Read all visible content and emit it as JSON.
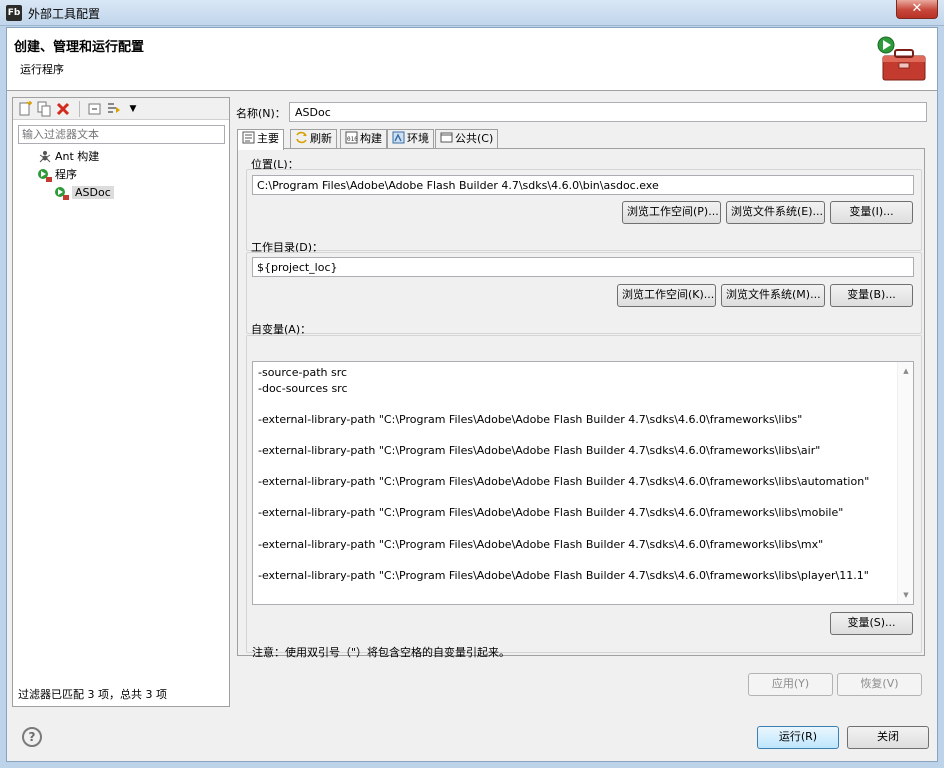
{
  "window": {
    "title": "外部工具配置",
    "app_icon_text": "Fb",
    "close_label": "✕"
  },
  "header": {
    "title": "创建、管理和运行配置",
    "subtitle": "运行程序"
  },
  "left": {
    "filter_placeholder": "输入过滤器文本",
    "tree": [
      {
        "label": "Ant 构建"
      },
      {
        "label": "程序"
      },
      {
        "label": "ASDoc",
        "selected": true
      }
    ],
    "status": "过滤器已匹配 3 项，总共 3 项"
  },
  "config": {
    "name_label": "名称(N)：",
    "name_value": "ASDoc",
    "tabs": [
      {
        "label": "主要",
        "active": true
      },
      {
        "label": "刷新"
      },
      {
        "label": "构建"
      },
      {
        "label": "环境"
      },
      {
        "label": "公共(C)"
      }
    ],
    "location": {
      "label": "位置(L)：",
      "value": "C:\\Program Files\\Adobe\\Adobe Flash Builder 4.7\\sdks\\4.6.0\\bin\\asdoc.exe",
      "browse_workspace": "浏览工作空间(P)...",
      "browse_fs": "浏览文件系统(E)...",
      "variables": "变量(I)..."
    },
    "workdir": {
      "label": "工作目录(D)：",
      "value": "${project_loc}",
      "browse_workspace": "浏览工作空间(K)...",
      "browse_fs": "浏览文件系统(M)...",
      "variables": "变量(B)..."
    },
    "arguments": {
      "label": "自变量(A)：",
      "lines": [
        "-source-path src",
        "-doc-sources src",
        "",
        "-external-library-path \"C:\\Program Files\\Adobe\\Adobe Flash Builder 4.7\\sdks\\4.6.0\\frameworks\\libs\"",
        "",
        "-external-library-path \"C:\\Program Files\\Adobe\\Adobe Flash Builder 4.7\\sdks\\4.6.0\\frameworks\\libs\\air\"",
        "",
        "-external-library-path \"C:\\Program Files\\Adobe\\Adobe Flash Builder 4.7\\sdks\\4.6.0\\frameworks\\libs\\automation\"",
        "",
        "-external-library-path \"C:\\Program Files\\Adobe\\Adobe Flash Builder 4.7\\sdks\\4.6.0\\frameworks\\libs\\mobile\"",
        "",
        "-external-library-path \"C:\\Program Files\\Adobe\\Adobe Flash Builder 4.7\\sdks\\4.6.0\\frameworks\\libs\\mx\"",
        "",
        "-external-library-path \"C:\\Program Files\\Adobe\\Adobe Flash Builder 4.7\\sdks\\4.6.0\\frameworks\\libs\\player\\11.1\""
      ],
      "variables": "变量(S)..."
    },
    "note": "注意：使用双引号（\"）将包含空格的自变量引起来。",
    "apply": "应用(Y)",
    "revert": "恢复(V)"
  },
  "footer": {
    "help_symbol": "?",
    "run": "运行(R)",
    "close": "关闭"
  }
}
